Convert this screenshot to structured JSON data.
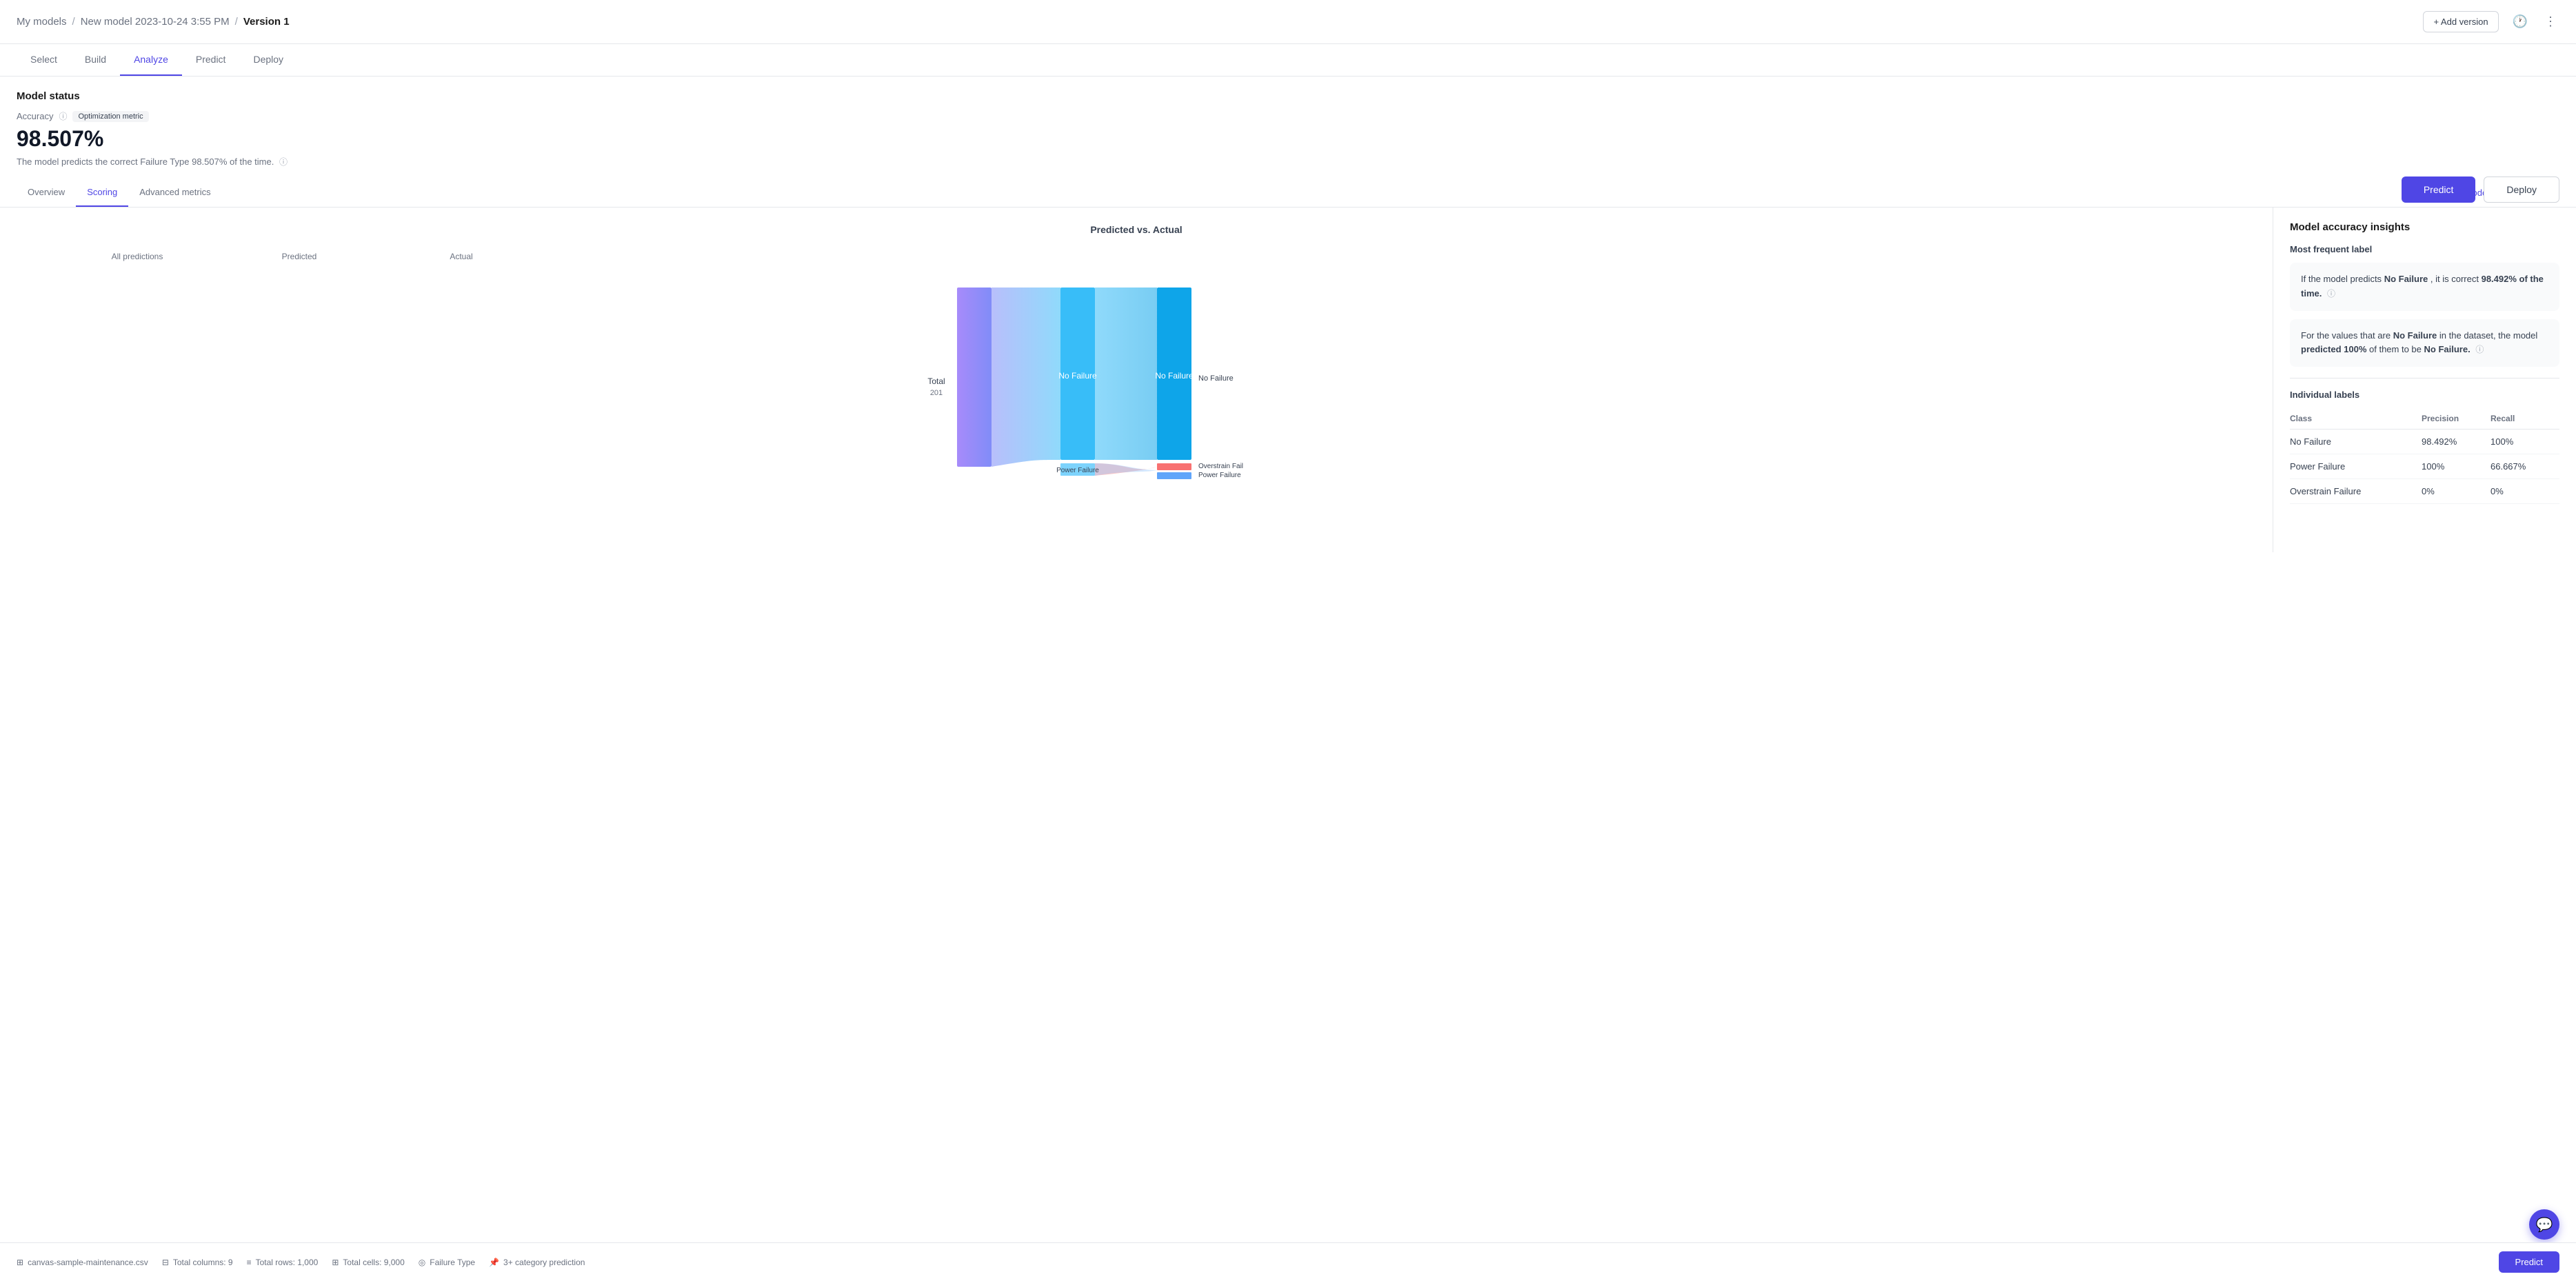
{
  "header": {
    "breadcrumb": "My models / New model 2023-10-24 3:55 PM / Version 1",
    "breadcrumb_parts": [
      "My models",
      "New model 2023-10-24 3:55 PM",
      "Version 1"
    ],
    "add_version_label": "+ Add version"
  },
  "nav": {
    "tabs": [
      {
        "label": "Select",
        "active": false
      },
      {
        "label": "Build",
        "active": false
      },
      {
        "label": "Analyze",
        "active": true
      },
      {
        "label": "Predict",
        "active": false
      },
      {
        "label": "Deploy",
        "active": false
      }
    ]
  },
  "model_status": {
    "title": "Model status",
    "accuracy_label": "Accuracy",
    "optimization_badge": "Optimization metric",
    "accuracy_value": "98.507%",
    "description": "The model predicts the correct Failure Type 98.507% of the time.",
    "predict_button": "Predict",
    "deploy_button": "Deploy"
  },
  "sub_tabs": {
    "tabs": [
      {
        "label": "Overview",
        "active": false
      },
      {
        "label": "Scoring",
        "active": true
      },
      {
        "label": "Advanced metrics",
        "active": false
      }
    ],
    "leaderboard_button": "Model leaderboard"
  },
  "chart": {
    "title": "Predicted vs. Actual",
    "labels": {
      "all_predictions": "All predictions",
      "predicted": "Predicted",
      "actual": "Actual"
    },
    "total_label": "Total",
    "total_value": "201",
    "bars": {
      "left_bar": {
        "label": "No Failure",
        "color_start": "#a78bfa",
        "color_end": "#818cf8"
      },
      "predicted_bar": {
        "label": "No Failure",
        "color": "#38bdf8"
      },
      "actual_bar": {
        "label": "No Failure",
        "color": "#0ea5e9"
      }
    },
    "flow_labels": {
      "power_failure": "Power Failure",
      "overstrain": "Overstrain Fail",
      "power_failure2": "Power Failure"
    }
  },
  "right_panel": {
    "title": "Model accuracy insights",
    "subtitle": "Most frequent label",
    "insight1": {
      "text_before": "If the model predicts",
      "highlight1": "No Failure",
      "text_middle": ", it is correct",
      "highlight2": "98.492% of the time."
    },
    "insight2": {
      "text_before": "For the values that are",
      "highlight1": "No Failure",
      "text_middle": " in the dataset, the model",
      "highlight2": "predicted 100%",
      "text_after": " of them to be",
      "highlight3": "No Failure."
    },
    "table": {
      "title": "Individual labels",
      "columns": [
        "Class",
        "Precision",
        "Recall"
      ],
      "rows": [
        {
          "class": "No Failure",
          "precision": "98.492%",
          "recall": "100%"
        },
        {
          "class": "Power Failure",
          "precision": "100%",
          "recall": "66.667%"
        },
        {
          "class": "Overstrain Failure",
          "precision": "0%",
          "recall": "0%"
        }
      ]
    }
  },
  "footer": {
    "file": "canvas-sample-maintenance.csv",
    "columns": "Total columns: 9",
    "rows": "Total rows: 1,000",
    "cells": "Total cells: 9,000",
    "target": "Failure Type",
    "prediction_type": "3+ category prediction",
    "predict_button": "Predict"
  }
}
